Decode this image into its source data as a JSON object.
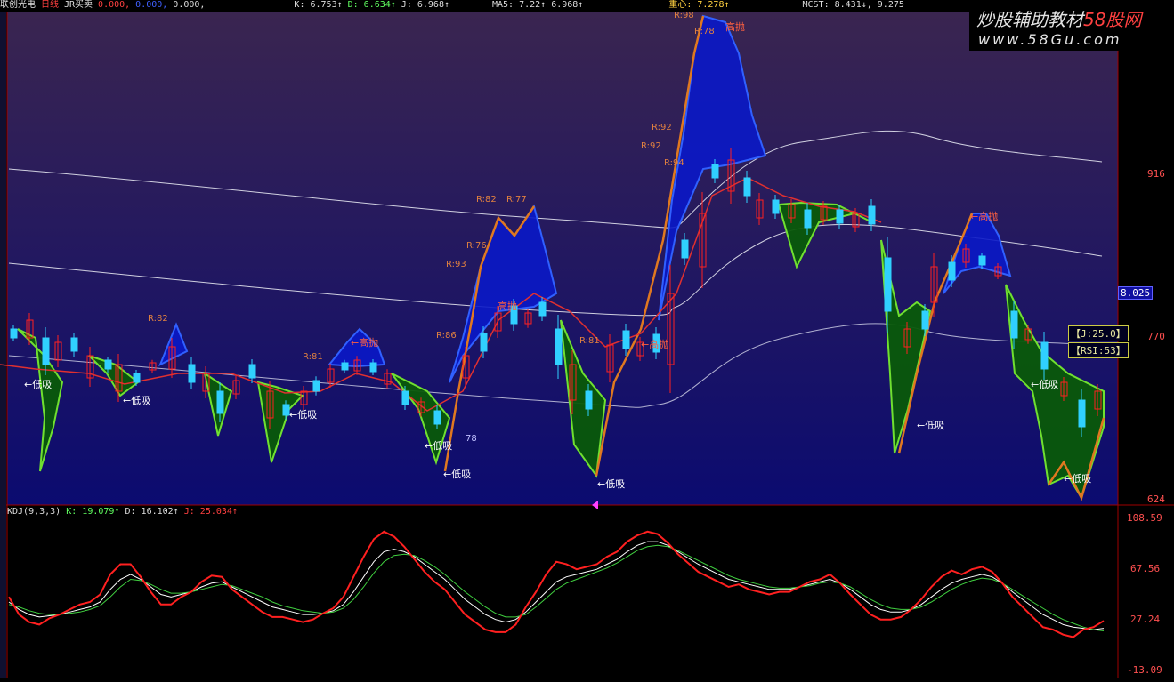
{
  "header": {
    "stock_name": "联创光电",
    "period": "日线",
    "indicator_name": "JR买卖",
    "zeros": [
      "0.000,",
      "0.000,",
      "0.000,"
    ],
    "k": "K: 6.753↑",
    "d": "D: 6.634↑",
    "j": "J: 6.968↑",
    "ma5": "MA5: 7.22↑",
    "ma5b": "6.968↑",
    "zhongxin": "重心: 7.278↑",
    "mcst": "MCST: 8.431↓, 9.275"
  },
  "watermark": {
    "brand": "炒股辅助教材",
    "brand_num": "58股网",
    "url": "www.58Gu.com"
  },
  "right_axis": {
    "ticks_main": [
      "916",
      "770",
      "624"
    ],
    "ticks_kdj": [
      "108.59",
      "67.56",
      "27.24",
      "-13.09"
    ],
    "current_price": "8.025"
  },
  "boxes": {
    "j_label": "【J:25.0】",
    "rsi_label": "【RSI:53】"
  },
  "kdj_header": {
    "title": "KDJ(9,3,3)",
    "k": "K: 19.079↑",
    "d": "D: 16.102↑",
    "j": "J: 25.034↑"
  },
  "signals": {
    "low": "←低吸",
    "high": "←高抛",
    "high_plain": "高抛",
    "r_labels": [
      "R:82",
      "R:81",
      "R:93",
      "R:76",
      "R:82",
      "R:77",
      "R:86",
      "R:81",
      "R:92",
      "R:92",
      "R:94",
      "R:98",
      "R:78"
    ],
    "small_78": "78"
  },
  "colors": {
    "bg_top": "#3a2550",
    "bg_bot": "#0b0b70",
    "up": "#ff2020",
    "down": "#30d0ff",
    "green_fill": "#0a5a0a",
    "blue_fill": "#0a18c8",
    "orange": "#e07820",
    "kdj_k": "#ffffff",
    "kdj_d": "#40d040",
    "kdj_j": "#ff2020"
  },
  "chart_data": {
    "type": "line",
    "title": "联创光电 日线 JR买卖",
    "series": [
      {
        "name": "K",
        "values": [
          40,
          34,
          30,
          28,
          29,
          30,
          32,
          34,
          36,
          40,
          50,
          58,
          62,
          58,
          52,
          46,
          44,
          46,
          48,
          52,
          55,
          56,
          52,
          48,
          44,
          40,
          36,
          34,
          32,
          30,
          30,
          31,
          33,
          38,
          48,
          60,
          72,
          80,
          82,
          80,
          76,
          70,
          64,
          58,
          50,
          42,
          36,
          30,
          26,
          24,
          26,
          32,
          40,
          48,
          56,
          60,
          62,
          64,
          66,
          70,
          74,
          80,
          85,
          88,
          88,
          85,
          80,
          75,
          70,
          66,
          62,
          58,
          56,
          54,
          52,
          50,
          50,
          50,
          52,
          54,
          56,
          58,
          55,
          50,
          44,
          38,
          34,
          32,
          32,
          34,
          38,
          44,
          50,
          55,
          58,
          60,
          62,
          60,
          55,
          48,
          42,
          36,
          30,
          26,
          22,
          20,
          19,
          18,
          19
        ]
      },
      {
        "name": "D",
        "values": [
          38,
          36,
          33,
          31,
          30,
          30,
          31,
          32,
          34,
          37,
          44,
          52,
          58,
          57,
          54,
          50,
          47,
          47,
          48,
          50,
          52,
          54,
          53,
          50,
          47,
          44,
          40,
          37,
          35,
          33,
          32,
          31,
          32,
          35,
          42,
          52,
          63,
          72,
          77,
          78,
          77,
          73,
          68,
          62,
          55,
          48,
          42,
          36,
          31,
          28,
          28,
          30,
          36,
          43,
          50,
          55,
          58,
          61,
          64,
          67,
          71,
          76,
          81,
          84,
          85,
          84,
          81,
          77,
          73,
          69,
          65,
          61,
          58,
          56,
          54,
          52,
          51,
          51,
          52,
          53,
          55,
          56,
          55,
          52,
          47,
          42,
          38,
          35,
          34,
          34,
          36,
          40,
          45,
          50,
          54,
          57,
          59,
          58,
          55,
          50,
          45,
          40,
          35,
          30,
          26,
          23,
          20,
          18,
          17
        ]
      },
      {
        "name": "J",
        "values": [
          44,
          30,
          24,
          22,
          27,
          30,
          34,
          38,
          40,
          46,
          62,
          70,
          70,
          60,
          48,
          38,
          38,
          44,
          48,
          56,
          61,
          60,
          50,
          44,
          38,
          32,
          28,
          28,
          26,
          24,
          26,
          31,
          35,
          44,
          60,
          76,
          90,
          96,
          92,
          84,
          74,
          64,
          56,
          50,
          40,
          30,
          24,
          18,
          16,
          16,
          22,
          36,
          48,
          62,
          72,
          70,
          66,
          68,
          70,
          76,
          80,
          88,
          93,
          96,
          94,
          87,
          78,
          71,
          64,
          60,
          56,
          52,
          54,
          50,
          48,
          46,
          48,
          48,
          52,
          56,
          58,
          62,
          55,
          46,
          38,
          30,
          26,
          26,
          28,
          34,
          42,
          52,
          60,
          65,
          62,
          66,
          68,
          64,
          55,
          44,
          36,
          28,
          20,
          18,
          14,
          12,
          18,
          20,
          25
        ]
      }
    ],
    "ylim": [
      -13.09,
      108.59
    ],
    "grid": false
  }
}
